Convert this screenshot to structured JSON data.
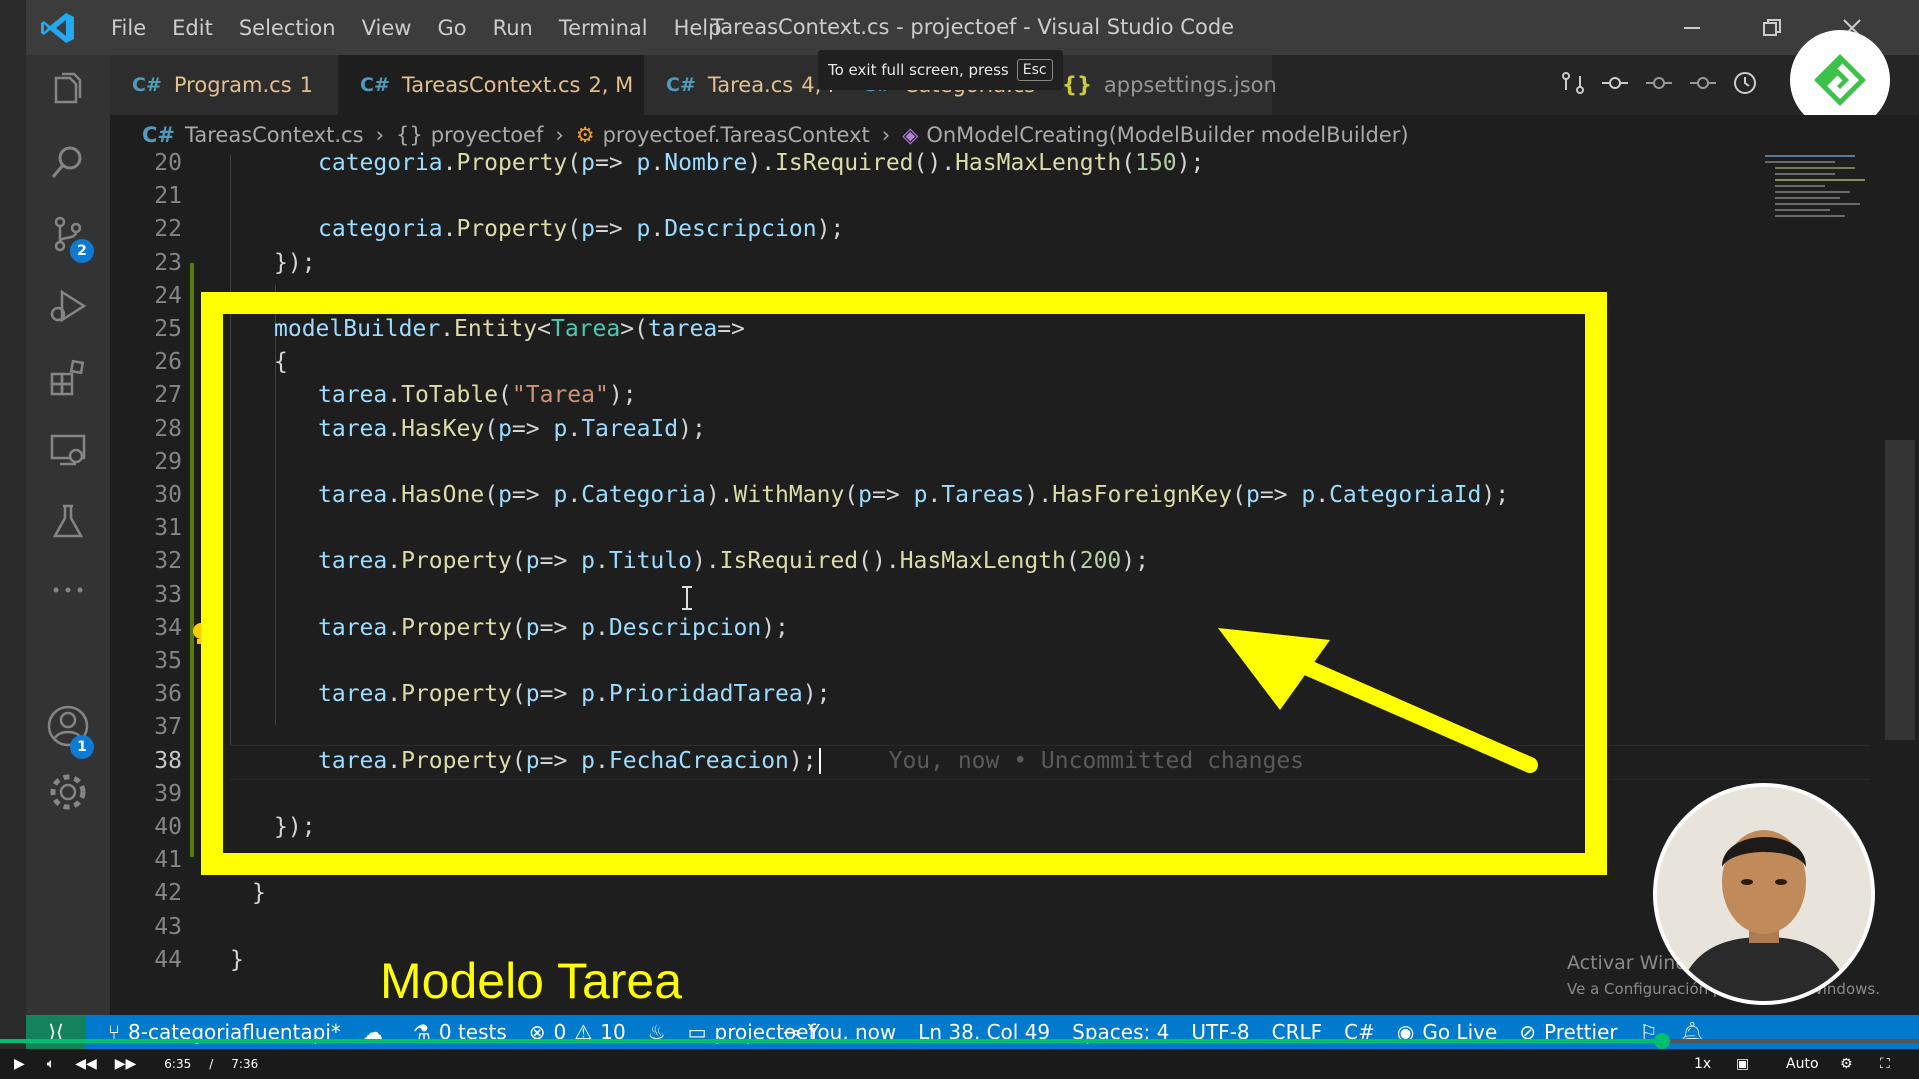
{
  "window": {
    "title": "TareasContext.cs - projectoef - Visual Studio Code",
    "menu": [
      "File",
      "Edit",
      "Selection",
      "View",
      "Go",
      "Run",
      "Terminal",
      "Help"
    ]
  },
  "activity_bar": {
    "source_control_badge": "2",
    "accounts_badge": "1",
    "icons": [
      "explorer-icon",
      "search-icon",
      "source-control-icon",
      "run-debug-icon",
      "extensions-icon",
      "remote-explorer-icon",
      "testing-icon",
      "more-icon",
      "accounts-icon",
      "settings-gear-icon"
    ]
  },
  "tabs": [
    {
      "label": "Program.cs",
      "suffix": "1",
      "active": false,
      "color": "#e2c08d"
    },
    {
      "label": "TareasContext.cs",
      "suffix": "2, M",
      "active": true,
      "color": "#e2c08d"
    },
    {
      "label": "Tarea.cs",
      "suffix": "4, M",
      "active": false,
      "color": "#e2c08d"
    },
    {
      "label": "Categoria.cs",
      "suffix": "3",
      "active": false,
      "color": "#e2c08d"
    },
    {
      "label": "appsettings.json",
      "suffix": "",
      "active": false,
      "color": "#969696"
    }
  ],
  "tooltip": {
    "text": "To exit full screen, press",
    "key": "Esc"
  },
  "breadcrumb": {
    "file": "TareasContext.cs",
    "namespace": "proyectoef",
    "class": "proyectoef.TareasContext",
    "method": "OnModelCreating(ModelBuilder modelBuilder)"
  },
  "code_lines": [
    {
      "n": "20",
      "tokens": [
        [
          "k",
          "categoria"
        ],
        [
          "p",
          "."
        ],
        [
          "m",
          "Property"
        ],
        [
          "p",
          "("
        ],
        [
          "k",
          "p"
        ],
        [
          "p",
          "=> "
        ],
        [
          "k",
          "p"
        ],
        [
          "p",
          "."
        ],
        [
          "k",
          "Nombre"
        ],
        [
          "p",
          ")."
        ],
        [
          "m",
          "IsRequired"
        ],
        [
          "p",
          "()."
        ],
        [
          "m",
          "HasMaxLength"
        ],
        [
          "p",
          "("
        ],
        [
          "n",
          "150"
        ],
        [
          "p",
          ");"
        ]
      ],
      "indent": 4
    },
    {
      "n": "21",
      "tokens": [],
      "indent": 0
    },
    {
      "n": "22",
      "tokens": [
        [
          "k",
          "categoria"
        ],
        [
          "p",
          "."
        ],
        [
          "m",
          "Property"
        ],
        [
          "p",
          "("
        ],
        [
          "k",
          "p"
        ],
        [
          "p",
          "=> "
        ],
        [
          "k",
          "p"
        ],
        [
          "p",
          "."
        ],
        [
          "k",
          "Descripcion"
        ],
        [
          "p",
          ");"
        ]
      ],
      "indent": 4
    },
    {
      "n": "23",
      "tokens": [
        [
          "p",
          "});"
        ]
      ],
      "indent": 2
    },
    {
      "n": "24",
      "tokens": [],
      "indent": 0
    },
    {
      "n": "25",
      "tokens": [
        [
          "k",
          "modelBuilder"
        ],
        [
          "p",
          "."
        ],
        [
          "m",
          "Entity"
        ],
        [
          "p",
          "<"
        ],
        [
          "t",
          "Tarea"
        ],
        [
          "p",
          ">("
        ],
        [
          "k",
          "tarea"
        ],
        [
          "p",
          "=>"
        ]
      ],
      "indent": 2
    },
    {
      "n": "26",
      "tokens": [
        [
          "p",
          "{"
        ]
      ],
      "indent": 2
    },
    {
      "n": "27",
      "tokens": [
        [
          "k",
          "tarea"
        ],
        [
          "p",
          "."
        ],
        [
          "m",
          "ToTable"
        ],
        [
          "p",
          "("
        ],
        [
          "s",
          "\"Tarea\""
        ],
        [
          "p",
          ");"
        ]
      ],
      "indent": 4
    },
    {
      "n": "28",
      "tokens": [
        [
          "k",
          "tarea"
        ],
        [
          "p",
          "."
        ],
        [
          "m",
          "HasKey"
        ],
        [
          "p",
          "("
        ],
        [
          "k",
          "p"
        ],
        [
          "p",
          "=> "
        ],
        [
          "k",
          "p"
        ],
        [
          "p",
          "."
        ],
        [
          "k",
          "TareaId"
        ],
        [
          "p",
          ");"
        ]
      ],
      "indent": 4
    },
    {
      "n": "29",
      "tokens": [],
      "indent": 0
    },
    {
      "n": "30",
      "tokens": [
        [
          "k",
          "tarea"
        ],
        [
          "p",
          "."
        ],
        [
          "m",
          "HasOne"
        ],
        [
          "p",
          "("
        ],
        [
          "k",
          "p"
        ],
        [
          "p",
          "=> "
        ],
        [
          "k",
          "p"
        ],
        [
          "p",
          "."
        ],
        [
          "k",
          "Categoria"
        ],
        [
          "p",
          ")."
        ],
        [
          "m",
          "WithMany"
        ],
        [
          "p",
          "("
        ],
        [
          "k",
          "p"
        ],
        [
          "p",
          "=> "
        ],
        [
          "k",
          "p"
        ],
        [
          "p",
          "."
        ],
        [
          "k",
          "Tareas"
        ],
        [
          "p",
          ")."
        ],
        [
          "m",
          "HasForeignKey"
        ],
        [
          "p",
          "("
        ],
        [
          "k",
          "p"
        ],
        [
          "p",
          "=> "
        ],
        [
          "k",
          "p"
        ],
        [
          "p",
          "."
        ],
        [
          "k",
          "CategoriaId"
        ],
        [
          "p",
          ");"
        ]
      ],
      "indent": 4
    },
    {
      "n": "31",
      "tokens": [],
      "indent": 0
    },
    {
      "n": "32",
      "tokens": [
        [
          "k",
          "tarea"
        ],
        [
          "p",
          "."
        ],
        [
          "m",
          "Property"
        ],
        [
          "p",
          "("
        ],
        [
          "k",
          "p"
        ],
        [
          "p",
          "=> "
        ],
        [
          "k",
          "p"
        ],
        [
          "p",
          "."
        ],
        [
          "k",
          "Titulo"
        ],
        [
          "p",
          ")."
        ],
        [
          "m",
          "IsRequired"
        ],
        [
          "p",
          "()."
        ],
        [
          "m",
          "HasMaxLength"
        ],
        [
          "p",
          "("
        ],
        [
          "n",
          "200"
        ],
        [
          "p",
          ");"
        ]
      ],
      "indent": 4
    },
    {
      "n": "33",
      "tokens": [],
      "indent": 0
    },
    {
      "n": "34",
      "tokens": [
        [
          "k",
          "tarea"
        ],
        [
          "p",
          "."
        ],
        [
          "m",
          "Property"
        ],
        [
          "p",
          "("
        ],
        [
          "k",
          "p"
        ],
        [
          "p",
          "=> "
        ],
        [
          "k",
          "p"
        ],
        [
          "p",
          "."
        ],
        [
          "k",
          "Descripcion"
        ],
        [
          "p",
          ");"
        ]
      ],
      "indent": 4
    },
    {
      "n": "35",
      "tokens": [],
      "indent": 0
    },
    {
      "n": "36",
      "tokens": [
        [
          "k",
          "tarea"
        ],
        [
          "p",
          "."
        ],
        [
          "m",
          "Property"
        ],
        [
          "p",
          "("
        ],
        [
          "k",
          "p"
        ],
        [
          "p",
          "=> "
        ],
        [
          "k",
          "p"
        ],
        [
          "p",
          "."
        ],
        [
          "k",
          "PrioridadTarea"
        ],
        [
          "p",
          ");"
        ]
      ],
      "indent": 4
    },
    {
      "n": "37",
      "tokens": [],
      "indent": 0
    },
    {
      "n": "38",
      "tokens": [
        [
          "k",
          "tarea"
        ],
        [
          "p",
          "."
        ],
        [
          "m",
          "Property"
        ],
        [
          "p",
          "("
        ],
        [
          "k",
          "p"
        ],
        [
          "p",
          "=> "
        ],
        [
          "k",
          "p"
        ],
        [
          "p",
          "."
        ],
        [
          "k",
          "FechaCreacion"
        ],
        [
          "p",
          ");"
        ]
      ],
      "indent": 4,
      "current": true
    },
    {
      "n": "39",
      "tokens": [],
      "indent": 0
    },
    {
      "n": "40",
      "tokens": [
        [
          "p",
          "});"
        ]
      ],
      "indent": 2
    },
    {
      "n": "41",
      "tokens": [],
      "indent": 0
    },
    {
      "n": "42",
      "tokens": [
        [
          "p",
          "}"
        ]
      ],
      "indent": 1
    },
    {
      "n": "43",
      "tokens": [],
      "indent": 0
    },
    {
      "n": "44",
      "tokens": [
        [
          "p",
          "}"
        ]
      ],
      "indent": 0
    }
  ],
  "blame": "You, now • Uncommitted changes",
  "annotation": "Modelo Tarea",
  "watermark": {
    "line1": "Activar Windows",
    "line2": "Ve a Configuración para activar Windows."
  },
  "statusbar": {
    "branch": "8-categoriafluentapi*",
    "tests": "0 tests",
    "errors": "0",
    "warnings": "10",
    "folder": "projectoef",
    "blame": "You, now",
    "position": "Ln 38, Col 49",
    "spaces": "Spaces: 4",
    "encoding": "UTF-8",
    "eol": "CRLF",
    "language": "C#",
    "go_live": "Go Live",
    "prettier": "Prettier"
  },
  "player": {
    "current_time": "6:35",
    "separator": "/",
    "duration": "7:36",
    "speed": "1x",
    "quality": "Auto",
    "progress": 0.866
  },
  "colors": {
    "accent": "#007acc",
    "highlight": "#ffff00",
    "progress": "#00c070"
  }
}
